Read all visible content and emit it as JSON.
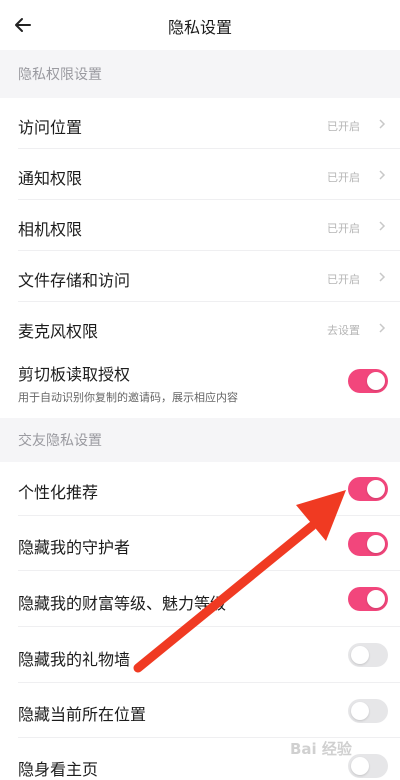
{
  "header": {
    "title": "隐私设置",
    "back_icon": "arrow-left-icon"
  },
  "sections": {
    "privacy_permissions": "隐私权限设置",
    "social_privacy": "交友隐私设置"
  },
  "permission_rows": [
    {
      "label": "访问位置",
      "value": "已开启"
    },
    {
      "label": "通知权限",
      "value": "已开启"
    },
    {
      "label": "相机权限",
      "value": "已开启"
    },
    {
      "label": "文件存储和访问",
      "value": "已开启"
    },
    {
      "label": "麦克风权限",
      "value": "去设置"
    }
  ],
  "clipboard": {
    "label": "剪切板读取授权",
    "description": "用于自动识别你复制的邀请码，展示相应内容",
    "enabled": true
  },
  "social_rows": [
    {
      "label": "个性化推荐",
      "enabled": true
    },
    {
      "label": "隐藏我的守护者",
      "enabled": true
    },
    {
      "label": "隐藏我的财富等级、魅力等级",
      "enabled": true
    },
    {
      "label": "隐藏我的礼物墙",
      "enabled": false
    },
    {
      "label": "隐藏当前所在位置",
      "enabled": false
    },
    {
      "label": "隐身看主页",
      "enabled": false
    }
  ],
  "colors": {
    "toggle_on": "#f2467c",
    "toggle_off": "#e6e6e8",
    "annotation_arrow": "#f03a22"
  },
  "watermark": "Bai 经验"
}
